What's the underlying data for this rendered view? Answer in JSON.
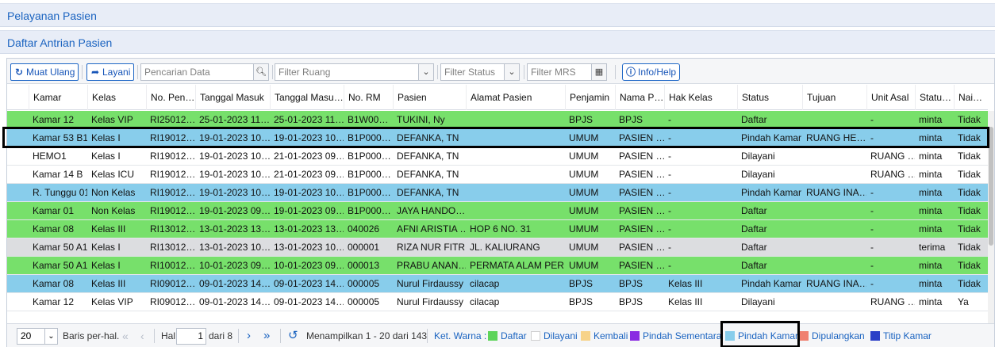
{
  "panels": {
    "title1": "Pelayanan Pasien",
    "title2": "Daftar Antrian Pasien"
  },
  "toolbar": {
    "reload_label": "Muat Ulang",
    "serve_label": "Layani",
    "search_placeholder": "Pencarian Data",
    "filter_room_placeholder": "Filter Ruang",
    "filter_status_placeholder": "Filter Status",
    "filter_mrs_placeholder": "Filter MRS",
    "help_label": "Info/Help"
  },
  "grid": {
    "columns": [
      "Kamar",
      "Kelas",
      "No. Pen…",
      "Tanggal Masuk",
      "Tanggal Masu…",
      "No. RM",
      "Pasien",
      "Alamat Pasien",
      "Penjamin",
      "Nama P…",
      "Hak Kelas",
      "Status",
      "Tujuan",
      "Unit Asal",
      "Statu…",
      "Nai…"
    ],
    "rows": [
      {
        "bg": "#77e06b",
        "cells": [
          "Kamar 12",
          "Kelas VIP",
          "RI25012…",
          "25-01-2023 11…",
          "25-01-2023 11…",
          "B1W00…",
          "TUKINI, Ny",
          "",
          "BPJS",
          "BPJS",
          "-",
          "Daftar",
          "",
          "-",
          "minta",
          "Tidak"
        ]
      },
      {
        "bg": "#88cdeb",
        "cells": [
          "Kamar 53 B1",
          "Kelas I",
          "RI19012…",
          "19-01-2023 10…",
          "19-01-2023 10…",
          "B1P000…",
          "DEFANKA, TN",
          "",
          "UMUM",
          "PASIEN …",
          "-",
          "Pindah Kamar",
          "RUANG HE…",
          "-",
          "minta",
          "Tidak"
        ]
      },
      {
        "bg": "#ffffff",
        "cells": [
          "HEMO1",
          "Kelas I",
          "RI19012…",
          "19-01-2023 10…",
          "21-01-2023 09…",
          "B1P000…",
          "DEFANKA, TN",
          "",
          "UMUM",
          "PASIEN …",
          "-",
          "Dilayani",
          "",
          "RUANG …",
          "minta",
          "Tidak"
        ]
      },
      {
        "bg": "#ffffff",
        "cells": [
          "Kamar 14 B",
          "Kelas ICU",
          "RI19012…",
          "19-01-2023 10…",
          "21-01-2023 09…",
          "B1P000…",
          "DEFANKA, TN",
          "",
          "UMUM",
          "PASIEN …",
          "-",
          "Dilayani",
          "",
          "RUANG …",
          "minta",
          "Tidak"
        ]
      },
      {
        "bg": "#88cdeb",
        "cells": [
          "R. Tunggu 01",
          "Non Kelas",
          "RI19012…",
          "19-01-2023 10…",
          "19-01-2023 10…",
          "B1P000…",
          "DEFANKA, TN",
          "",
          "UMUM",
          "PASIEN …",
          "-",
          "Pindah Kamar",
          "RUANG INA…",
          "-",
          "minta",
          "Tidak"
        ]
      },
      {
        "bg": "#77e06b",
        "cells": [
          "Kamar 01",
          "Non Kelas",
          "RI19012…",
          "19-01-2023 09…",
          "19-01-2023 09…",
          "B1P000…",
          "JAYA HANDO…",
          "",
          "UMUM",
          "PASIEN …",
          "-",
          "Daftar",
          "",
          "-",
          "minta",
          "Tidak"
        ]
      },
      {
        "bg": "#77e06b",
        "cells": [
          "Kamar 08",
          "Kelas III",
          "RI13012…",
          "13-01-2023 13…",
          "13-01-2023 13…",
          "040026",
          "AFNI ARISTIA …",
          "HOP 6 NO. 31",
          "UMUM",
          "PASIEN …",
          "-",
          "Daftar",
          "",
          "-",
          "minta",
          "Tidak"
        ]
      },
      {
        "bg": "#dcdde0",
        "cells": [
          "Kamar 50 A1",
          "Kelas I",
          "RI13012…",
          "13-01-2023 10…",
          "13-01-2023 10…",
          "000001",
          "RIZA NUR FITR…",
          "JL. KALIURANG",
          "UMUM",
          "PASIEN …",
          "-",
          "Daftar",
          "",
          "-",
          "terima",
          "Tidak"
        ]
      },
      {
        "bg": "#77e06b",
        "cells": [
          "Kamar 50 A1",
          "Kelas I",
          "RI10012…",
          "10-01-2023 09…",
          "10-01-2023 09…",
          "000013",
          "PRABU ANAN…",
          "PERMATA ALAM PER…",
          "UMUM",
          "PASIEN …",
          "-",
          "Daftar",
          "",
          "-",
          "minta",
          "Tidak"
        ]
      },
      {
        "bg": "#88cdeb",
        "cells": [
          "Kamar 08",
          "Kelas III",
          "RI09012…",
          "09-01-2023 14…",
          "09-01-2023 14…",
          "000005",
          "Nurul Firdaussy",
          "cilacap",
          "BPJS",
          "BPJS",
          "Kelas III",
          "Pindah Kamar",
          "RUANG INA…",
          "-",
          "minta",
          "Tidak"
        ]
      },
      {
        "bg": "#ffffff",
        "cells": [
          "Kamar 12",
          "Kelas VIP",
          "RI09012…",
          "09-01-2023 14…",
          "09-01-2023 14…",
          "000005",
          "Nurul Firdaussy",
          "cilacap",
          "BPJS",
          "BPJS",
          "Kelas III",
          "Dilayani",
          "",
          "RUANG …",
          "minta",
          "Ya"
        ]
      }
    ]
  },
  "pager": {
    "page_size": "20",
    "per_page_label": "Baris per-hal.",
    "page_label": "Hal",
    "current_page": "1",
    "of_pages": "dari 8",
    "showing": "Menampilkan 1 - 20 dari 143",
    "legend_title": "Ket. Warna :",
    "legend": [
      {
        "label": "Daftar",
        "color": "#5ed45a"
      },
      {
        "label": "Dilayani",
        "color": "#ffffff"
      },
      {
        "label": "Kembali",
        "color": "#f7d38a"
      },
      {
        "label": "Pindah Sementara",
        "color": "#8a2be2"
      },
      {
        "label": "Pindah Kamar",
        "color": "#88cdeb"
      },
      {
        "label": "Dipulangkan",
        "color": "#f08070"
      },
      {
        "label": "Titip Kamar",
        "color": "#2b3fc7"
      }
    ]
  }
}
